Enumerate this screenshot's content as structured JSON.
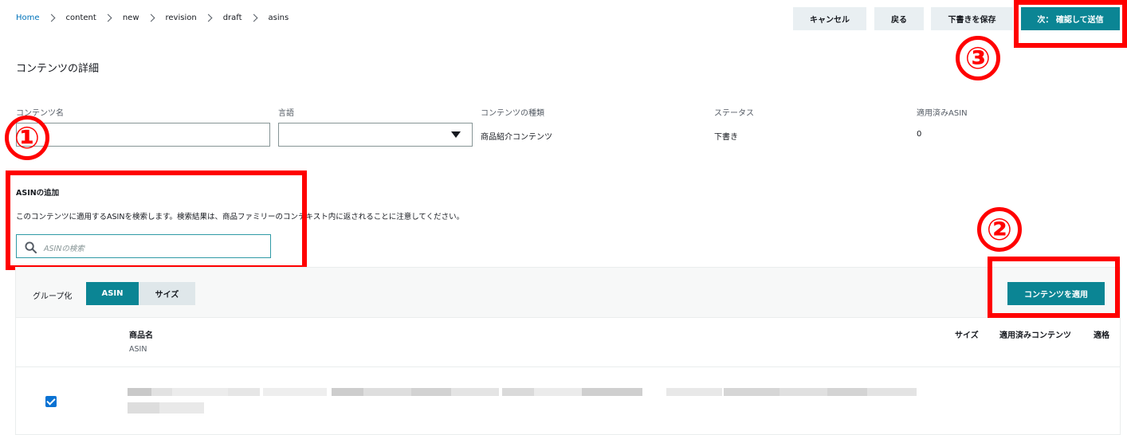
{
  "breadcrumb": [
    "Home",
    "content",
    "new",
    "revision",
    "draft",
    "asins"
  ],
  "buttons": {
    "cancel": "キャンセル",
    "back": "戻る",
    "save_draft": "下書きを保存",
    "next_submit": "次： 確認して送信"
  },
  "section_title": "コンテンツの詳細",
  "fields": {
    "content_name_label": "コンテンツ名",
    "content_name_value": "",
    "language_label": "言語",
    "language_value": "",
    "content_type_label": "コンテンツの種類",
    "content_type_value": "商品紹介コンテンツ",
    "status_label": "ステータス",
    "status_value": "下書き",
    "applied_asin_label": "適用済みASIN",
    "applied_asin_value": "0"
  },
  "asin_add": {
    "title": "ASINの追加",
    "description": "このコンテンツに適用するASINを検索します。検索結果は、商品ファミリーのコンテキスト内に返されることに注意してください。",
    "search_placeholder": "ASINの検索"
  },
  "grouping": {
    "label": "グループ化",
    "options": [
      "ASIN",
      "サイズ"
    ],
    "selected": "ASIN"
  },
  "apply_button": "コンテンツを適用",
  "table": {
    "columns": {
      "product_name": "商品名",
      "asin": "ASIN",
      "size": "サイズ",
      "applied_content": "適用済みコンテンツ",
      "eligible": "適格"
    },
    "rows": [
      {
        "checked": true,
        "product_name": "",
        "asin": ""
      }
    ]
  },
  "annotations": [
    "①",
    "②",
    "③"
  ],
  "colors": {
    "primary": "#0b8594",
    "secondary": "#e9eff2",
    "annotation": "#ff0000",
    "link": "#0073bb"
  }
}
